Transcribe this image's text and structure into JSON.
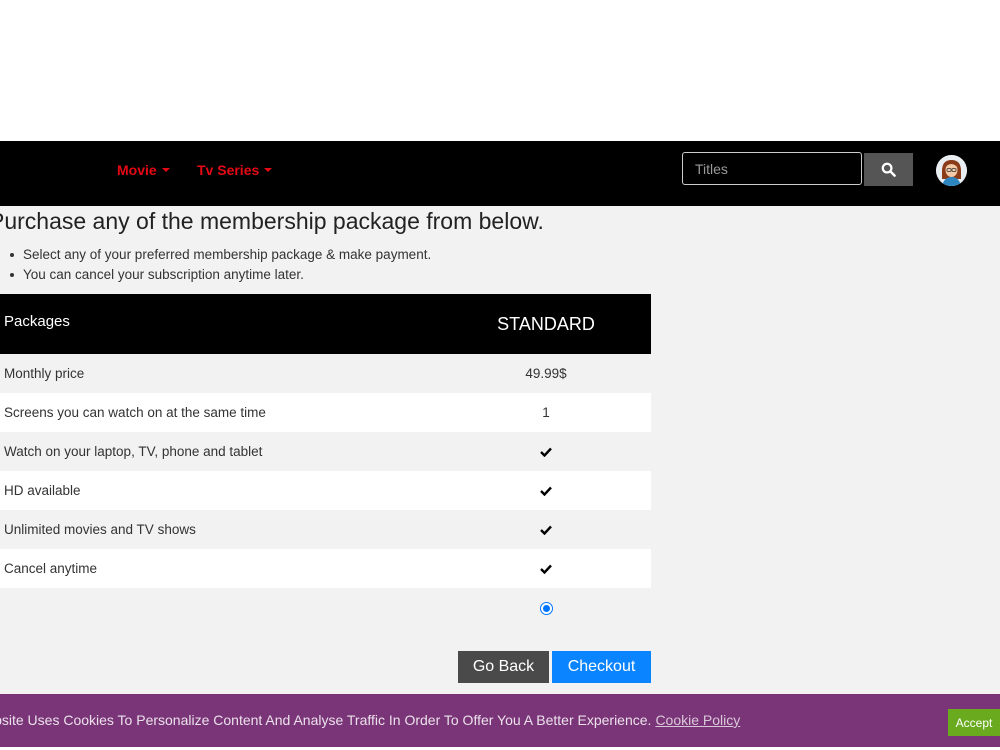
{
  "navbar": {
    "items": [
      {
        "label": "Movie"
      },
      {
        "label": "Tv Series"
      }
    ],
    "search": {
      "placeholder": "Titles"
    }
  },
  "main": {
    "heading": "Purchase any of the membership package from below.",
    "bullets": [
      "Select any of your preferred membership package & make payment.",
      "You can cancel your subscription anytime later."
    ],
    "table": {
      "header_label": "Packages",
      "package_name": "STANDARD",
      "rows": [
        {
          "label": "Monthly price",
          "value": "49.99$"
        },
        {
          "label": "Screens you can watch on at the same time",
          "value": "1"
        },
        {
          "label": "Watch on your laptop, TV, phone and tablet",
          "value": "check"
        },
        {
          "label": "HD available",
          "value": "check"
        },
        {
          "label": "Unlimited movies and TV shows",
          "value": "check"
        },
        {
          "label": "Cancel anytime",
          "value": "check"
        }
      ]
    },
    "buttons": {
      "back": "Go Back",
      "checkout": "Checkout"
    }
  },
  "cookie": {
    "text": "This Website Uses Cookies To Personalize Content And Analyse Traffic In Order To Offer You A Better Experience.",
    "link": "Cookie Policy",
    "accept": "Accept"
  },
  "colors": {
    "nav_accent": "#e50914",
    "checkout": "#0a84ff",
    "cookie_bar": "#7a3578",
    "accept": "#6aaa1e"
  },
  "icons": [
    "caret-down-icon",
    "search-icon",
    "avatar",
    "check-icon",
    "radio-selected"
  ]
}
